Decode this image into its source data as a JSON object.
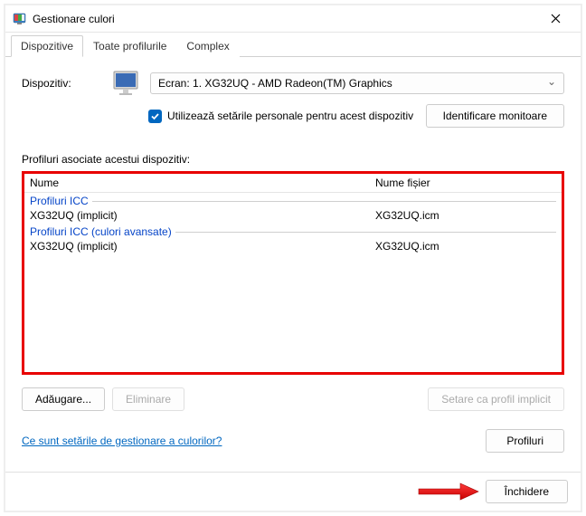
{
  "window": {
    "title": "Gestionare culori"
  },
  "tabs": [
    {
      "label": "Dispozitive",
      "active": true
    },
    {
      "label": "Toate profilurile",
      "active": false
    },
    {
      "label": "Complex",
      "active": false
    }
  ],
  "device": {
    "label": "Dispozitiv:",
    "selected": "Ecran: 1. XG32UQ - AMD Radeon(TM) Graphics"
  },
  "checkbox": {
    "checked": true,
    "label": "Utilizează setările personale pentru acest dispozitiv"
  },
  "identify_button": "Identificare monitoare",
  "profiles_label": "Profiluri asociate acestui dispozitiv:",
  "columns": {
    "name": "Nume",
    "file": "Nume fișier"
  },
  "groups": [
    {
      "title": "Profiluri ICC",
      "rows": [
        {
          "name": "XG32UQ (implicit)",
          "file": "XG32UQ.icm"
        }
      ]
    },
    {
      "title": "Profiluri ICC (culori avansate)",
      "rows": [
        {
          "name": "XG32UQ (implicit)",
          "file": "XG32UQ.icm"
        }
      ]
    }
  ],
  "buttons": {
    "add": "Adăugare...",
    "remove": "Eliminare",
    "set_default": "Setare ca profil implicit",
    "profiles": "Profiluri",
    "close": "Închidere"
  },
  "help_link": "Ce sunt setările de gestionare a culorilor?"
}
